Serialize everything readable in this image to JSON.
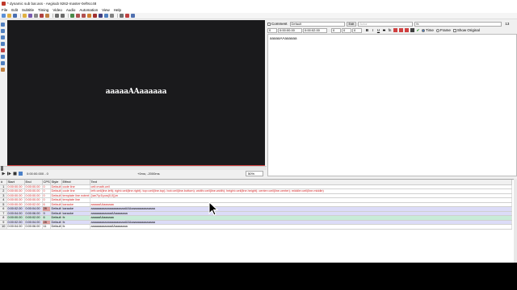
{
  "window": {
    "title": "* dynamic sub bar.ass - Aegisub 9262-master-0ef9cc48"
  },
  "menu": [
    "File",
    "Edit",
    "Subtitle",
    "Timing",
    "Video",
    "Audio",
    "Automation",
    "View",
    "Help"
  ],
  "video": {
    "caption": "aaaaaAAaaaaaa"
  },
  "video_controls": {
    "timecode": "0:00:00.000 - 0",
    "offset": "+0ms; -2000ms",
    "zoom": "50%"
  },
  "edit": {
    "comment_label": "Comment",
    "style": "Default",
    "edit_button": "Edit",
    "actor_placeholder": "Actor",
    "effect": "fx",
    "count": "13",
    "layer": "0",
    "start": "0:00:00.00",
    "end": "0:00:02.00",
    "margin_l": "0",
    "margin_r": "0",
    "margin_v": "0",
    "time_label": "Time",
    "frame_label": "Frame",
    "show_original_label": "Show Original",
    "text": "aaaaaAAaaaaaa"
  },
  "grid": {
    "headers": [
      "#",
      "Start",
      "End",
      "CPS",
      "Style",
      "Effect",
      "Text"
    ],
    "rows": [
      {
        "n": "1",
        "start": "0:00:00.00",
        "end": "0:00:00.00",
        "cps": "0",
        "style": "Default",
        "effect": "code line",
        "text": "ceil=math.ceil",
        "kind": "comment"
      },
      {
        "n": "2",
        "start": "0:00:00.00",
        "end": "0:00:00.00",
        "cps": "0",
        "style": "Default",
        "effect": "code line",
        "text": "left=ceil(line.left); right=ceil(line.right); top=ceil(line.top); bot=ceil(line.bottom); width=ceil(line.width); height=ceil(line.height); center=ceil(line.center); middle=ceil(line.middle)",
        "kind": "comment"
      },
      {
        "n": "3",
        "start": "0:00:00.00",
        "end": "0:00:00.00",
        "cps": "0",
        "style": "Default",
        "effect": "template line notext",
        "text": "{\\an7\\p1\\pos(0,0)}m",
        "kind": "comment"
      },
      {
        "n": "4",
        "start": "0:00:00.00",
        "end": "0:00:00.00",
        "cps": "0",
        "style": "Default",
        "effect": "template line",
        "text": "",
        "kind": "comment"
      },
      {
        "n": "5",
        "start": "0:00:00.00",
        "end": "0:00:02.00",
        "cps": "6",
        "style": "Default",
        "effect": "karaoke",
        "text": "aaaaaAAaaaaaa",
        "kind": "comment"
      },
      {
        "n": "6",
        "start": "0:00:02.00",
        "end": "0:00:04.00",
        "cps": "28",
        "style": "Default",
        "effect": "karaoke",
        "text": "aaaaaaaaaaaaaaaaaaaaAAAaaaaaaaaaaaaaa",
        "kind": "tint"
      },
      {
        "n": "7",
        "start": "0:00:04.00",
        "end": "0:00:06.00",
        "cps": "9",
        "style": "Default",
        "effect": "karaoke",
        "text": "aaaaaaaaaaaaAAaaaaaaa",
        "kind": "tint"
      },
      {
        "n": "8",
        "start": "0:00:00.00",
        "end": "0:00:02.00",
        "cps": "6",
        "style": "Default",
        "effect": "fx",
        "text": "aaaaaAAaaaaaa",
        "kind": "selected"
      },
      {
        "n": "9",
        "start": "0:00:02.00",
        "end": "0:00:04.00",
        "cps": "28",
        "style": "Default",
        "effect": "fx",
        "text": "aaaaaaaaaaaaaaaaaaaaAAAaaaaaaaaaaaaaa",
        "kind": "tint"
      },
      {
        "n": "10",
        "start": "0:00:04.00",
        "end": "0:00:06.00",
        "cps": "11",
        "style": "Default",
        "effect": "fx",
        "text": "aaaaaaaaaaaaAAaaaaaaa",
        "kind": "plain"
      }
    ]
  },
  "colors": {
    "video_bg": "#1a1a1c",
    "comment_text": "#d02020",
    "row_tint": "#dcdcf8",
    "row_selected": "#c8ecd8",
    "cps_high": "#e0a0a0"
  }
}
